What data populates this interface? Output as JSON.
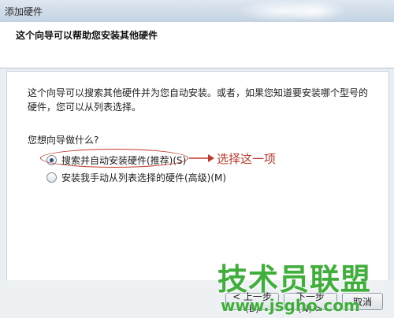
{
  "window": {
    "title": "添加硬件"
  },
  "header": {
    "title": "这个向导可以帮助您安装其他硬件"
  },
  "body": {
    "intro": "这个向导可以搜索其他硬件并为您自动安装。或者，如果您知道要安装哪个型号的硬件，您可以从列表选择。",
    "question": "您想向导做什么?",
    "options": [
      {
        "label": "搜索并自动安装硬件(推荐)(S)",
        "selected": true
      },
      {
        "label": "安装我手动从列表选择的硬件(高级)(M)",
        "selected": false
      }
    ]
  },
  "annotation": {
    "text": "选择这一项",
    "color": "#c0392b"
  },
  "footer": {
    "back_label": "< 上一步(B)",
    "next_label": "下一步(N) >",
    "cancel_label": "取消"
  },
  "watermark": {
    "brand": "技术员联盟",
    "url": "www.jsgho.com"
  },
  "colors": {
    "watermark": "#3fae3a",
    "titlebar": "#cfdbe8"
  }
}
